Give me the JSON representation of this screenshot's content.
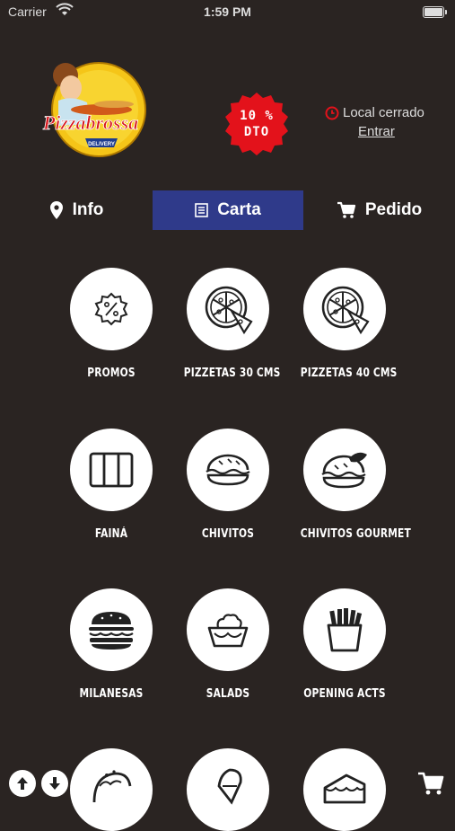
{
  "status_bar": {
    "carrier": "Carrier",
    "time": "1:59 PM"
  },
  "header": {
    "logo_text": "Pizzabrossa",
    "logo_subtext": "DELIVERY",
    "discount_badge": {
      "line1": "10 %",
      "line2": "DTO"
    },
    "store_status": "Local cerrado",
    "enter_link": "Entrar"
  },
  "tabs": [
    {
      "label": "Info",
      "icon": "location-pin-icon",
      "active": false
    },
    {
      "label": "Carta",
      "icon": "menu-list-icon",
      "active": true
    },
    {
      "label": "Pedido",
      "icon": "cart-icon",
      "active": false
    }
  ],
  "categories": [
    {
      "label": "PROMOS",
      "icon": "discount-badge-icon"
    },
    {
      "label": "PIZZETAS 30 CMS",
      "icon": "pizza-icon"
    },
    {
      "label": "PIZZETAS 40 CMS",
      "icon": "pizza-icon"
    },
    {
      "label": "FAINÁ",
      "icon": "faina-tray-icon"
    },
    {
      "label": "CHIVITOS",
      "icon": "sandwich-icon"
    },
    {
      "label": "CHIVITOS GOURMET",
      "icon": "gourmet-sandwich-icon"
    },
    {
      "label": "MILANESAS",
      "icon": "burger-icon"
    },
    {
      "label": "SALADS",
      "icon": "salad-bowl-icon"
    },
    {
      "label": "OPENING ACTS",
      "icon": "fries-icon"
    },
    {
      "label": "",
      "icon": "taco-icon"
    },
    {
      "label": "",
      "icon": "ice-cream-icon"
    },
    {
      "label": "",
      "icon": "cake-icon"
    }
  ],
  "colors": {
    "background": "#2a2422",
    "active_tab": "#2f3a8a",
    "badge_red": "#e3121b",
    "logo_yellow": "#f5c518"
  }
}
